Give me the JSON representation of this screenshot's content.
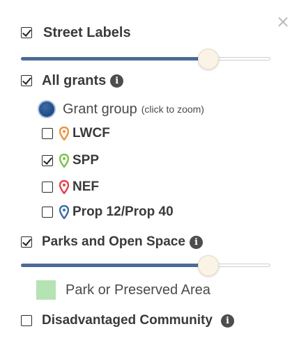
{
  "panel": {
    "close_glyph": "×",
    "street_labels": {
      "label": "Street Labels",
      "checked": true,
      "slider_value": 0.75
    },
    "all_grants": {
      "label": "All grants",
      "checked": true,
      "info_glyph": "i",
      "legend": {
        "label": "Grant group",
        "hint": "(click to zoom)",
        "color": "#2a5893"
      },
      "items": [
        {
          "label": "LWCF",
          "checked": false,
          "pin_color": "#f0923a",
          "icon": "map-pin-icon"
        },
        {
          "label": "SPP",
          "checked": true,
          "pin_color": "#7cc24a",
          "icon": "map-pin-icon"
        },
        {
          "label": "NEF",
          "checked": false,
          "pin_color": "#e5414b",
          "icon": "map-pin-icon"
        },
        {
          "label": "Prop 12/Prop 40",
          "checked": false,
          "pin_color": "#3c6ca7",
          "icon": "map-pin-icon"
        }
      ]
    },
    "parks": {
      "label": "Parks and Open Space",
      "checked": true,
      "info_glyph": "i",
      "slider_value": 0.75,
      "legend": {
        "label": "Park or Preserved Area",
        "color": "#b6e3b4"
      }
    },
    "disadvantaged": {
      "label": "Disadvantaged Community",
      "checked": false,
      "info_glyph": "i"
    }
  },
  "colors": {
    "slider_fill": "#4a6b96",
    "thumb": "#fbf4e6",
    "text": "#3a3a3a"
  }
}
